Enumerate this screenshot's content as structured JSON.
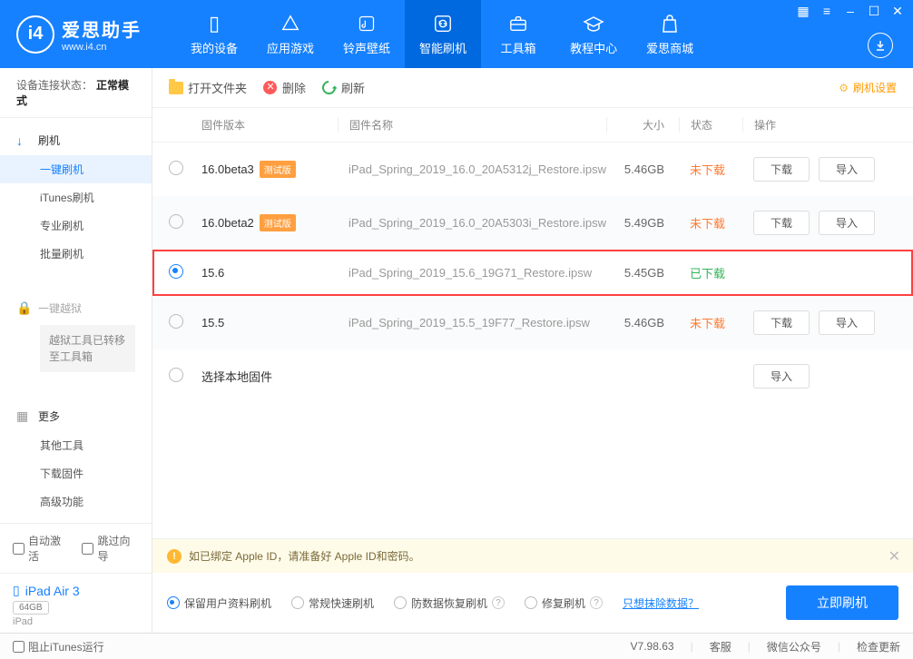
{
  "logo": {
    "name": "爱思助手",
    "url": "www.i4.cn",
    "letter": "i4"
  },
  "nav": [
    {
      "label": "我的设备"
    },
    {
      "label": "应用游戏"
    },
    {
      "label": "铃声壁纸"
    },
    {
      "label": "智能刷机"
    },
    {
      "label": "工具箱"
    },
    {
      "label": "教程中心"
    },
    {
      "label": "爱思商城"
    }
  ],
  "sidebar": {
    "statusLabel": "设备连接状态：",
    "statusValue": "正常模式",
    "flash": {
      "label": "刷机",
      "items": [
        "一键刷机",
        "iTunes刷机",
        "专业刷机",
        "批量刷机"
      ]
    },
    "jailbreak": {
      "label": "一键越狱",
      "notice": "越狱工具已转移至工具箱"
    },
    "more": {
      "label": "更多",
      "items": [
        "其他工具",
        "下载固件",
        "高级功能"
      ]
    },
    "autoActivate": "自动激活",
    "skipGuide": "跳过向导",
    "device": {
      "name": "iPad Air 3",
      "capacity": "64GB",
      "type": "iPad"
    }
  },
  "toolbar": {
    "open": "打开文件夹",
    "delete": "删除",
    "refresh": "刷新",
    "settings": "刷机设置"
  },
  "table": {
    "headers": {
      "version": "固件版本",
      "name": "固件名称",
      "size": "大小",
      "status": "状态",
      "actions": "操作"
    },
    "badgeText": "测试版",
    "statusText": {
      "not": "未下载",
      "done": "已下载"
    },
    "buttons": {
      "download": "下载",
      "import": "导入"
    },
    "localLabel": "选择本地固件",
    "rows": [
      {
        "version": "16.0beta3",
        "beta": true,
        "name": "iPad_Spring_2019_16.0_20A5312j_Restore.ipsw",
        "size": "5.46GB",
        "status": "not",
        "selected": false,
        "actions": true
      },
      {
        "version": "16.0beta2",
        "beta": true,
        "name": "iPad_Spring_2019_16.0_20A5303i_Restore.ipsw",
        "size": "5.49GB",
        "status": "not",
        "selected": false,
        "actions": true
      },
      {
        "version": "15.6",
        "beta": false,
        "name": "iPad_Spring_2019_15.6_19G71_Restore.ipsw",
        "size": "5.45GB",
        "status": "done",
        "selected": true,
        "actions": false
      },
      {
        "version": "15.5",
        "beta": false,
        "name": "iPad_Spring_2019_15.5_19F77_Restore.ipsw",
        "size": "5.46GB",
        "status": "not",
        "selected": false,
        "actions": true
      }
    ]
  },
  "notice": "如已绑定 Apple ID，请准备好 Apple ID和密码。",
  "flashOptions": {
    "items": [
      "保留用户资料刷机",
      "常规快速刷机",
      "防数据恢复刷机",
      "修复刷机"
    ],
    "eraseLink": "只想抹除数据？",
    "flashBtn": "立即刷机"
  },
  "footer": {
    "blockItunes": "阻止iTunes运行",
    "version": "V7.98.63",
    "service": "客服",
    "wechat": "微信公众号",
    "update": "检查更新"
  }
}
